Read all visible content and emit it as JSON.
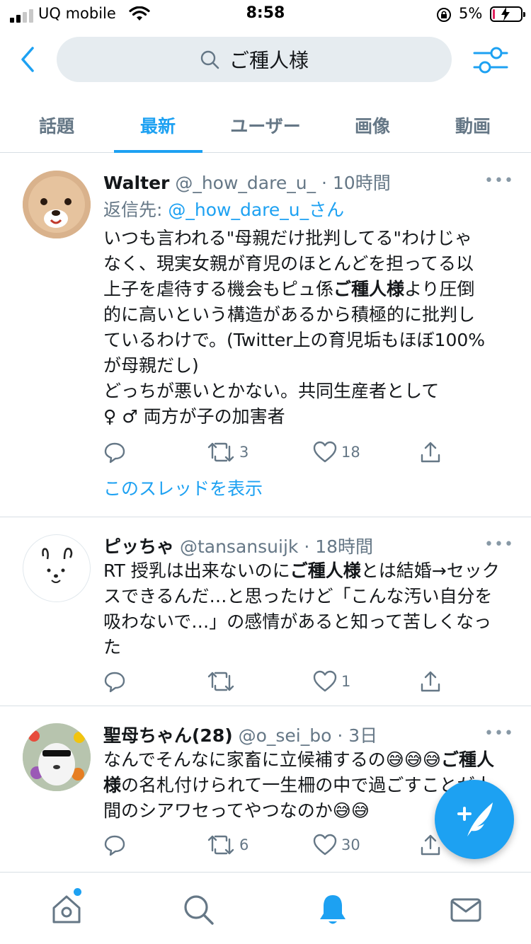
{
  "status_bar": {
    "carrier": "UQ mobile",
    "time": "8:58",
    "battery_percent": "5%",
    "battery_level": 0.05,
    "signal_bars_on": 2
  },
  "search": {
    "query": "ご種人様"
  },
  "tabs": [
    {
      "label": "話題",
      "active": false
    },
    {
      "label": "最新",
      "active": true
    },
    {
      "label": "ユーザー",
      "active": false
    },
    {
      "label": "画像",
      "active": false
    },
    {
      "label": "動画",
      "active": false
    }
  ],
  "tweets": [
    {
      "name": "Walter",
      "handle": "@_how_dare_u_",
      "dot": "·",
      "time": "10時間",
      "reply_prefix": "返信先:",
      "reply_to": "@_how_dare_u_さん",
      "lines": [
        "いつも言われる\"母親だけ批判してる\"わけじゃ",
        "なく、現実女親が育児のほとんどを担ってる以",
        "上子を虐待する機会もピュ係",
        "ご種人様",
        "より圧倒",
        "的に高いという構造があるから積極的に批判し",
        "ているわけで。(Twitter上の育児垢もほぼ100%",
        "が母親だし)",
        "どっちが悪いとかない。共同生産者として",
        "♀ ♂ 両方が子の加害者"
      ],
      "retweets": "3",
      "likes": "18",
      "thread_link": "このスレッドを表示"
    },
    {
      "name": "ピッちゃ",
      "handle": "@tansansuijk",
      "dot": "·",
      "time": "18時間",
      "text_a": "RT 授乳は出来ないのに",
      "highlight": "ご種人様",
      "text_b": "とは結婚→セックスできるんだ…と思ったけど「こんな汚い自分を吸わないで…」の感情があると知って苦しくなった",
      "retweets": "",
      "likes": "1"
    },
    {
      "name": "聖母ちゃん(28)",
      "handle": "@o_sei_bo",
      "dot": "·",
      "time": "3日",
      "text_a": "なんでそんなに家畜に立候補するの",
      "emoji": "😅",
      "highlight": "ご種人様",
      "text_b": "の名札付けられて一生柵の中で過ごすことが人間のシアワセってやつなのか",
      "retweets": "6",
      "likes": "30"
    }
  ],
  "more_label": "•••",
  "colors": {
    "accent": "#1da1f2",
    "text": "#14171a",
    "secondary": "#657786",
    "search_bg": "#e6ecf0",
    "battery_low": "#e0245e"
  },
  "icons": [
    "back-chevron-icon",
    "search-icon",
    "filter-sliders-icon",
    "reply-icon",
    "retweet-icon",
    "like-icon",
    "share-icon",
    "compose-icon",
    "home-icon",
    "explore-icon",
    "notifications-icon",
    "messages-icon"
  ]
}
